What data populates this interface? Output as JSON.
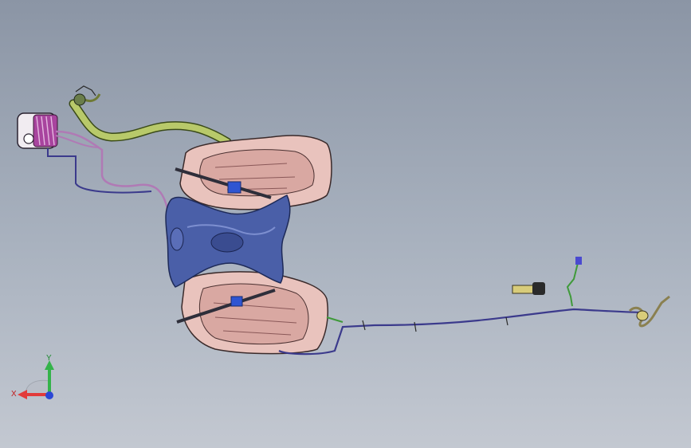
{
  "viewport": {
    "background_top": "#8b95a5",
    "background_bottom": "#c3c8d1"
  },
  "model": {
    "tank_shell_color": "#e9c3bd",
    "tank_edge_color": "#3a2a2a",
    "bracket_color": "#4a5fa8",
    "tube_color": "#3b3a8c",
    "filler_hose_color": "#b8c96a",
    "accent_pink": "#b07ab5",
    "connector_green": "#3f9a3a",
    "connector_yellow": "#d8cc7a"
  },
  "triad": {
    "x_label": "X",
    "y_label": "Y",
    "x_color": "#e23a3a",
    "y_color": "#34b34a",
    "z_color": "#2b47d6"
  }
}
